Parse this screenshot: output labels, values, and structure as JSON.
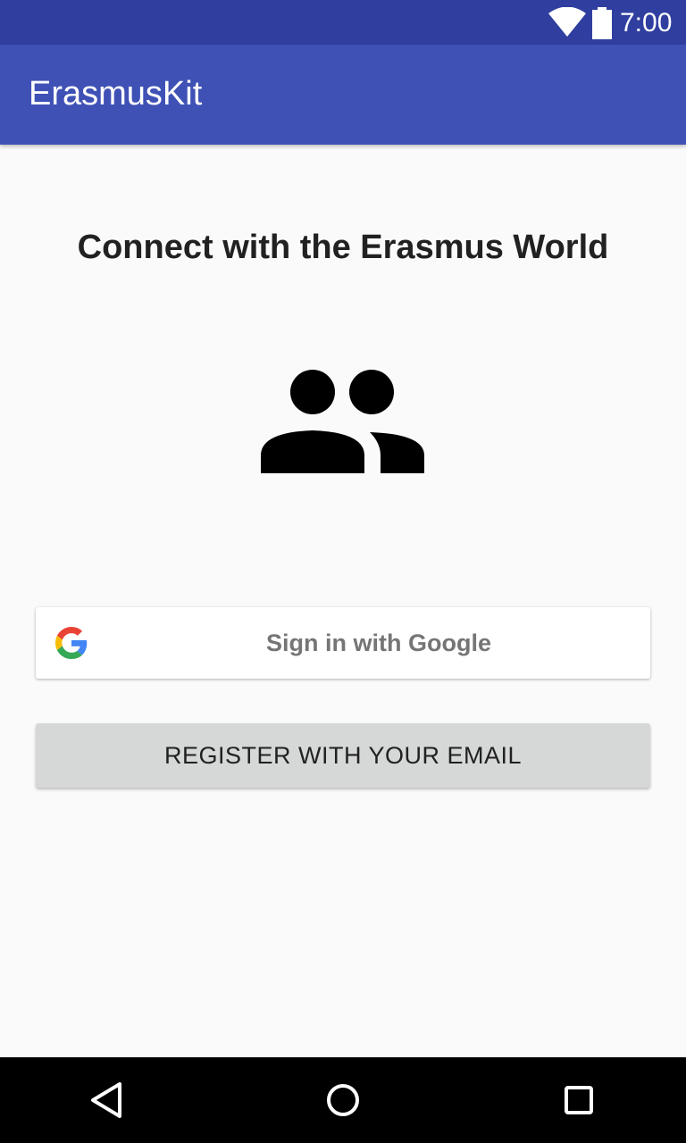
{
  "status_bar": {
    "time": "7:00",
    "icons": [
      "wifi-icon",
      "battery-icon"
    ]
  },
  "app_bar": {
    "title": "ErasmusKit",
    "color": "#3f51b5"
  },
  "main": {
    "headline": "Connect with the Erasmus World",
    "illustration_icon": "people-icon",
    "google_button": {
      "label": "Sign in with Google",
      "icon": "google-logo-icon"
    },
    "email_button": {
      "label": "REGISTER WITH YOUR EMAIL"
    }
  },
  "nav_bar": {
    "buttons": [
      "back-icon",
      "home-icon",
      "recents-icon"
    ]
  },
  "colors": {
    "status_bar": "#303f9f",
    "app_bar": "#3f51b5",
    "background": "#fafafa",
    "email_button": "#d6d7d7"
  }
}
